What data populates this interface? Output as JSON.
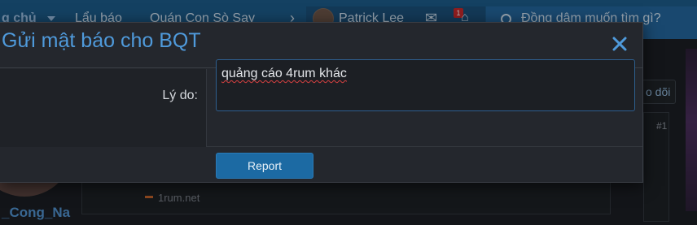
{
  "nav": {
    "home_label": "g chủ",
    "items": [
      "Lẩu báo",
      "Quán Con Sò Say"
    ],
    "user_name": "Patrick Lee",
    "alert_count": "1",
    "search_placeholder": "Đồng dâm muốn tìm gì?"
  },
  "background": {
    "username": "_Cong_Na",
    "follow_label": "o dõi",
    "post_number": "#1",
    "link_text": "1rum.net"
  },
  "modal": {
    "title": "Gửi mật báo cho BQT",
    "reason_label": "Lý do:",
    "reason_value": "quảng cáo 4rum khác",
    "submit_label": "Report"
  },
  "colors": {
    "accent": "#4f9adb",
    "button": "#1c6aa3",
    "nav": "#1d5a88"
  }
}
